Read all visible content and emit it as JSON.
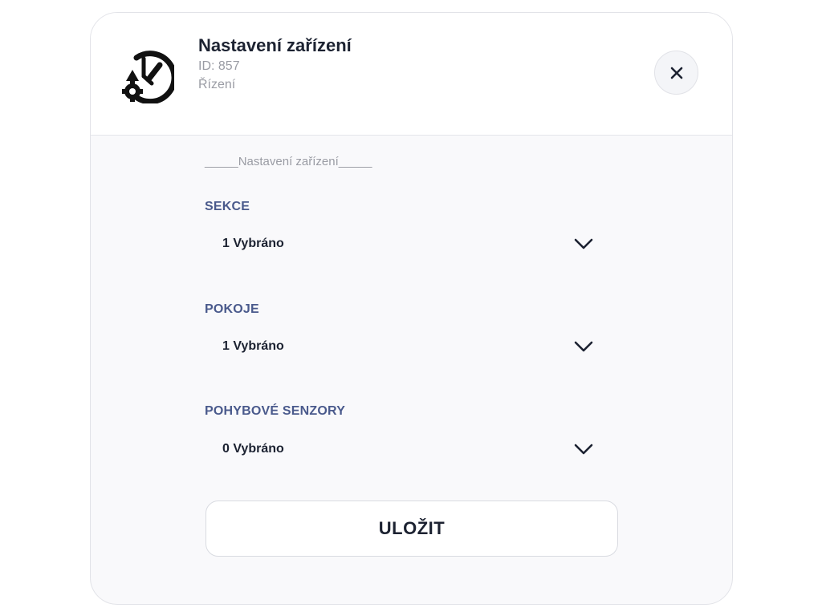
{
  "header": {
    "title": "Nastavení zařízení",
    "id_text": "ID: 857",
    "category": "Řízení",
    "icon": "clock-gear-icon"
  },
  "form": {
    "section_heading": "_____Nastavení zařízení_____",
    "fields": [
      {
        "label": "SEKCE",
        "value": "1 Vybráno"
      },
      {
        "label": "POKOJE",
        "value": "1 Vybráno"
      },
      {
        "label": "POHYBOVÉ SENZORY",
        "value": "0 Vybráno"
      }
    ]
  },
  "actions": {
    "save_label": "ULOŽIT"
  },
  "colors": {
    "title_text": "#1c2231",
    "label_text": "#4a5a8c",
    "muted_text": "#9a9ca4",
    "panel_bg": "#f9f9fb"
  }
}
